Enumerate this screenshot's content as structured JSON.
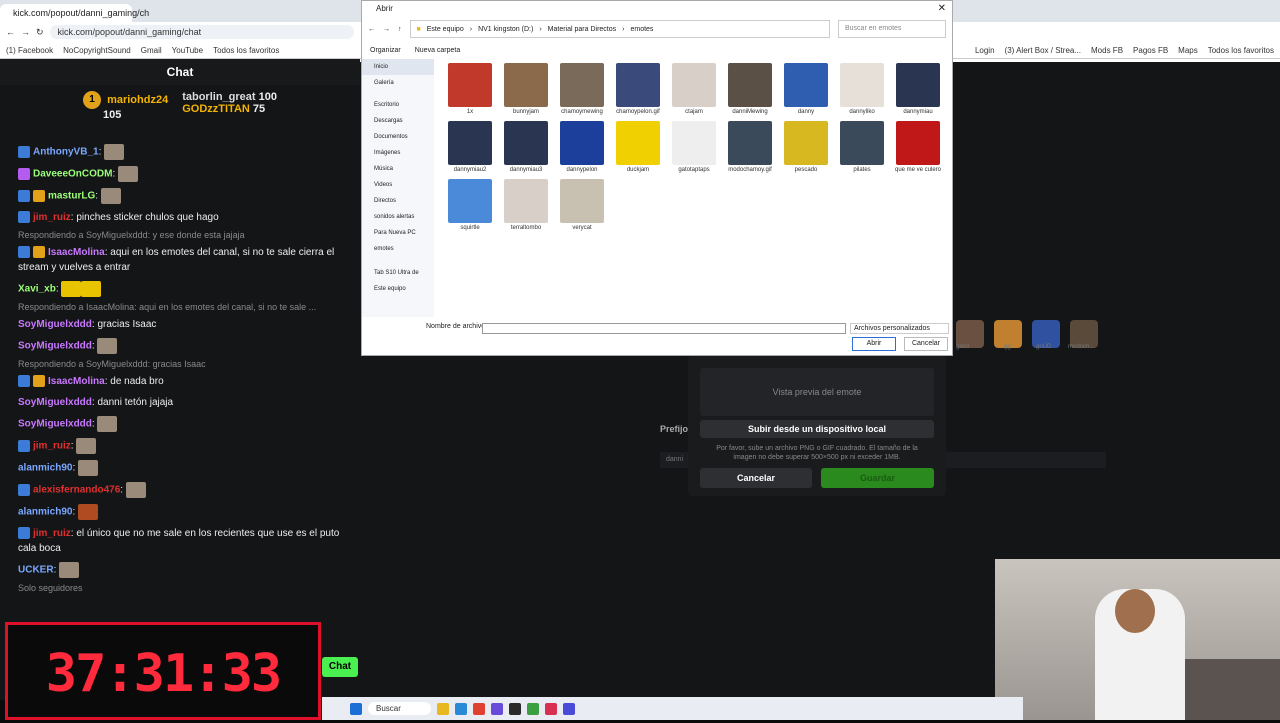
{
  "chat_browser": {
    "tab_title": "kick.com/popout/danni_gaming/ch",
    "url": "kick.com/popout/danni_gaming/chat",
    "bookmarks": [
      "(1) Facebook",
      "NoCopyrightSound",
      "Gmail",
      "YouTube",
      "Todos los favoritos"
    ],
    "title": "Chat",
    "leaders": {
      "first": {
        "rank": "1",
        "name": "mariohdz24",
        "amount": "105"
      },
      "second": {
        "name": "taborlin_great",
        "amount": "100"
      },
      "third": {
        "name": "GODzzTITAN",
        "amount": "75"
      }
    },
    "messages": [
      {
        "user": "AnthonyVB_1",
        "text": ":",
        "color": "u1"
      },
      {
        "user": "DaveeeOnCODM",
        "text": ":",
        "color": "u4"
      },
      {
        "user": "masturLG",
        "text": ":",
        "color": "u4"
      },
      {
        "user": "jim_ruiz",
        "text": ": pinches sticker chulos que hago",
        "color": "u5"
      },
      {
        "reply": "Respondiendo a SoyMiguelxddd: y ese donde esta jajaja"
      },
      {
        "user": "IsaacMolina",
        "text": ": aqui en los emotes del canal, si no te sale cierra el stream y vuelves a entrar",
        "color": "u3"
      },
      {
        "user": "Xavi_xb",
        "text": ":",
        "color": "u4"
      },
      {
        "reply": "Respondiendo a IsaacMolina: aqui en los emotes del canal, si no te sale ..."
      },
      {
        "user": "SoyMiguelxddd",
        "text": ": gracias Isaac",
        "color": "u3"
      },
      {
        "user": "SoyMiguelxddd",
        "text": ":",
        "color": "u3"
      },
      {
        "reply": "Respondiendo a SoyMiguelxddd: gracias Isaac"
      },
      {
        "user": "IsaacMolina",
        "text": ": de nada bro",
        "color": "u3"
      },
      {
        "user": "SoyMiguelxddd",
        "text": ": danni tetón jajaja",
        "color": "u3"
      },
      {
        "user": "SoyMiguelxddd",
        "text": ":",
        "color": "u3"
      },
      {
        "user": "jim_ruiz",
        "text": ":",
        "color": "u5"
      },
      {
        "user": "alanmich90",
        "text": ":",
        "color": "u1"
      },
      {
        "user": "alexisfernando476",
        "text": ":",
        "color": "u5"
      },
      {
        "user": "alanmich90",
        "text": ":",
        "color": "u1"
      },
      {
        "user": "jim_ruiz",
        "text": ": el único que no me sale en los recientes que use es el puto cala boca",
        "color": "u5"
      },
      {
        "user": "UCKER",
        "text": ":",
        "color": "u1"
      }
    ],
    "followers_only": "Solo seguidores",
    "chat_button": "Chat"
  },
  "timer": {
    "display": "37:31:33"
  },
  "file_dialog": {
    "title": "Abrir",
    "breadcrumb": [
      "Este equipo",
      "NV1 kingston (D:)",
      "Material para Directos",
      "emotes"
    ],
    "search_placeholder": "Buscar en emotes",
    "toolbar": [
      "Organizar",
      "Nueva carpeta"
    ],
    "sidebar": [
      "Inicio",
      "Galería",
      "Escritorio",
      "Descargas",
      "Documentos",
      "Imágenes",
      "Música",
      "Videos",
      "Directos",
      "sonidos alertas",
      "Para Nueva PC",
      "emotes",
      "Tab S10 Ultra de",
      "Este equipo"
    ],
    "files": [
      {
        "name": "1x",
        "color": "#c0392b"
      },
      {
        "name": "bunnyjam",
        "color": "#8a6a4a"
      },
      {
        "name": "chamoymewing",
        "color": "#7a6a5a"
      },
      {
        "name": "chamoypelon.gif",
        "color": "#3a4a7a"
      },
      {
        "name": "ctajam",
        "color": "#d8d0c8"
      },
      {
        "name": "danniMewing",
        "color": "#5a5046"
      },
      {
        "name": "danny",
        "color": "#2f5db0"
      },
      {
        "name": "dannyliko",
        "color": "#e6e0d8"
      },
      {
        "name": "dannymiau",
        "color": "#2a3552"
      },
      {
        "name": "dannymiau2",
        "color": "#2a3552"
      },
      {
        "name": "dannymiau3",
        "color": "#2a3552"
      },
      {
        "name": "dannypelon",
        "color": "#1b3f9a"
      },
      {
        "name": "duckjam",
        "color": "#f0d000"
      },
      {
        "name": "gatotaptaps",
        "color": "#eeeeee"
      },
      {
        "name": "modochamoy.gif",
        "color": "#3a4a5a"
      },
      {
        "name": "pescado",
        "color": "#d8b820"
      },
      {
        "name": "pilates",
        "color": "#3a4a5a"
      },
      {
        "name": "que me ve culero",
        "color": "#c01818"
      },
      {
        "name": "squirtle",
        "color": "#4a8ad8"
      },
      {
        "name": "terraltombo",
        "color": "#d8d0c8"
      },
      {
        "name": "verycat",
        "color": "#c8c0b0"
      }
    ],
    "filename_label": "Nombre de archivo:",
    "filetype": "Archivos personalizados",
    "open_label": "Abrir",
    "cancel_label": "Cancelar"
  },
  "right_browser": {
    "bookmarks": [
      "Login",
      "(3) Alert Box / Strea...",
      "Mods FB",
      "Pagos FB",
      "Maps",
      "Todos los favoritos"
    ]
  },
  "dashboard": {
    "emotes": [
      "gatol",
      "gg",
      "goUD",
      "modoch..."
    ],
    "emote_prefix_label": "Prefijo",
    "prefix_value": "danni"
  },
  "modal": {
    "preview_label": "Vista previa del emote",
    "upload_label": "Subir desde un dispositivo local",
    "hint": "Por favor, sube un archivo PNG o GIF cuadrado. El tamaño de la imagen no debe superar 500×500 px ni exceder 1MB.",
    "cancel_label": "Cancelar",
    "save_label": "Guardar"
  },
  "taskbar": {
    "search_placeholder": "Buscar"
  }
}
